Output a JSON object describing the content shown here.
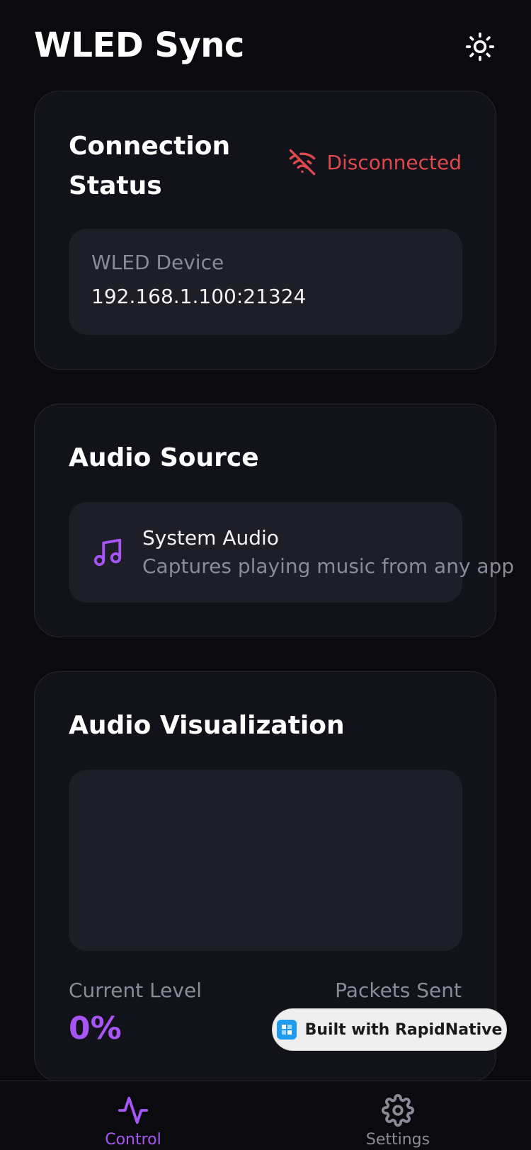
{
  "header": {
    "title": "WLED Sync",
    "theme_icon": "sun-icon"
  },
  "connection": {
    "title": "Connection Status",
    "status": "Disconnected",
    "status_icon": "wifi-off-icon",
    "status_color": "#e0484d",
    "device_label": "WLED Device",
    "device_address": "192.168.1.100:21324"
  },
  "audio_source": {
    "title": "Audio Source",
    "icon": "music-note-icon",
    "name": "System Audio",
    "description": "Captures playing music from any app"
  },
  "visualization": {
    "title": "Audio Visualization",
    "current_level_label": "Current Level",
    "current_level_value": "0%",
    "packets_sent_label": "Packets Sent"
  },
  "badge": {
    "label": "Built with RapidNative"
  },
  "bottom_nav": {
    "tabs": [
      {
        "label": "Control",
        "icon": "activity-icon",
        "active": true
      },
      {
        "label": "Settings",
        "icon": "gear-icon",
        "active": false
      }
    ]
  },
  "colors": {
    "background": "#0b0b0f",
    "card": "#12121a",
    "accent": "#a855f7",
    "error": "#e0484d"
  }
}
